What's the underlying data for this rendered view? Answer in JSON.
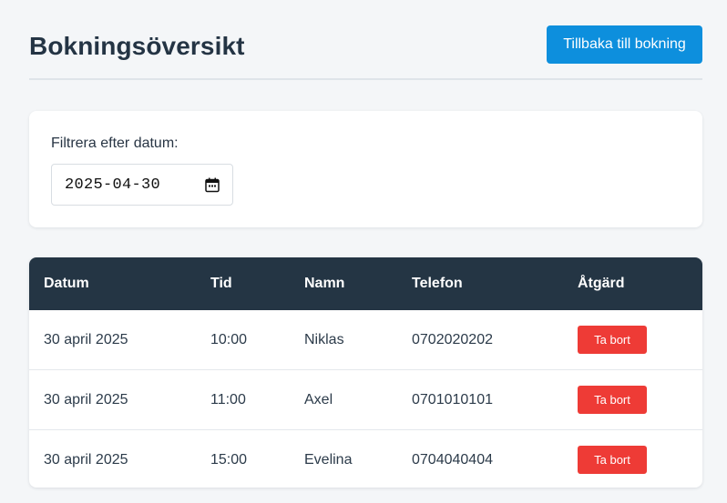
{
  "page": {
    "title": "Bokningsöversikt",
    "back_button_label": "Tillbaka till bokning"
  },
  "filter": {
    "label": "Filtrera efter datum:",
    "date_value": "2025-04-30",
    "icon": "calendar-icon"
  },
  "table": {
    "columns": [
      "Datum",
      "Tid",
      "Namn",
      "Telefon",
      "Åtgärd"
    ],
    "rows": [
      {
        "date": "30 april 2025",
        "time": "10:00",
        "name": "Niklas",
        "phone": "0702020202",
        "action": "Ta bort"
      },
      {
        "date": "30 april 2025",
        "time": "11:00",
        "name": "Axel",
        "phone": "0701010101",
        "action": "Ta bort"
      },
      {
        "date": "30 april 2025",
        "time": "15:00",
        "name": "Evelina",
        "phone": "0704040404",
        "action": "Ta bort"
      }
    ]
  },
  "colors": {
    "primary": "#0d8fdd",
    "header_dark": "#243544",
    "danger": "#ee3b36",
    "background": "#f4f6f8"
  }
}
